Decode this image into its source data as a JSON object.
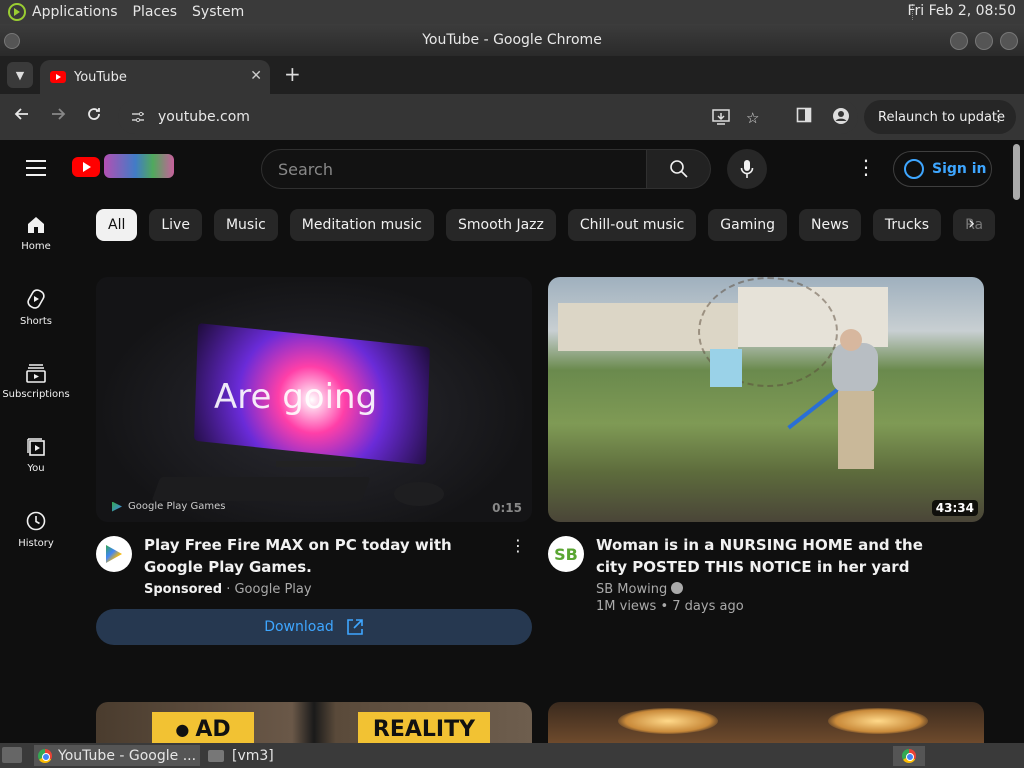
{
  "os_panel": {
    "menus": [
      "Applications",
      "Places",
      "System"
    ],
    "clock": "Fri Feb  2, 08:50"
  },
  "window": {
    "title": "YouTube - Google Chrome"
  },
  "tabs": [
    {
      "label": "YouTube"
    }
  ],
  "toolbar": {
    "url": "youtube.com",
    "relaunch_label": "Relaunch to update"
  },
  "masthead": {
    "search_placeholder": "Search",
    "signin_label": "Sign in"
  },
  "guide": [
    {
      "label": "Home",
      "icon": "home-icon"
    },
    {
      "label": "Shorts",
      "icon": "shorts-icon"
    },
    {
      "label": "Subscriptions",
      "icon": "subscriptions-icon"
    },
    {
      "label": "You",
      "icon": "you-icon"
    },
    {
      "label": "History",
      "icon": "history-icon"
    }
  ],
  "chips": [
    "All",
    "Live",
    "Music",
    "Meditation music",
    "Smooth Jazz",
    "Chill-out music",
    "Gaming",
    "News",
    "Trucks",
    "Ra"
  ],
  "videos": [
    {
      "title": "Play Free Fire MAX on PC today with Google Play Games.",
      "sponsored": "Sponsored",
      "channel": "Google Play",
      "duration": "0:15",
      "thumb_text": "Are   going",
      "thumb_brand": "Google Play Games",
      "cta": "Download"
    },
    {
      "title": "Woman is in a NURSING HOME and the city POSTED THIS NOTICE in her yard",
      "channel": "SB Mowing",
      "avatar_text": "SB",
      "views": "1M views",
      "age": "7 days ago",
      "duration": "43:34"
    }
  ],
  "row2": {
    "ad_text": "AD",
    "reality_text": "REALITY"
  },
  "taskbar": {
    "tasks": [
      "YouTube - Google ...",
      "[vm3]"
    ]
  },
  "colors": {
    "accent_blue": "#3ea6ff",
    "youtube_red": "#ff0000",
    "background": "#0f0f0f"
  }
}
